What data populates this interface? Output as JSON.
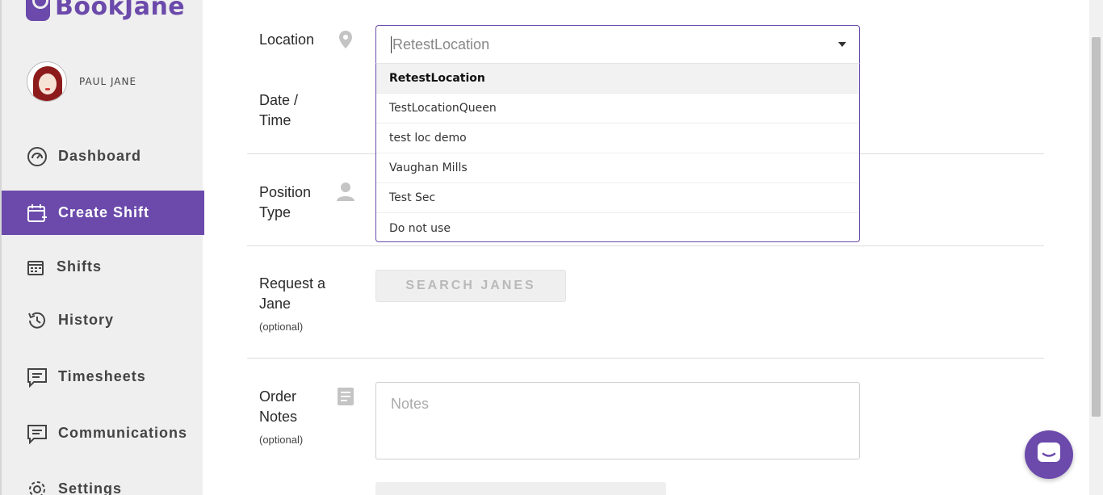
{
  "brand": {
    "name": "BookJane",
    "color": "#6b4aab"
  },
  "user": {
    "name": "PAUL JANE"
  },
  "sidebar": {
    "items": [
      {
        "label": "Dashboard",
        "icon": "dashboard-gauge-icon"
      },
      {
        "label": "Create Shift",
        "icon": "calendar-plus-icon",
        "active": true
      },
      {
        "label": "Shifts",
        "icon": "calendar-icon"
      },
      {
        "label": "History",
        "icon": "history-clock-icon"
      },
      {
        "label": "Timesheets",
        "icon": "timesheet-message-icon"
      },
      {
        "label": "Communications",
        "icon": "communications-message-icon"
      },
      {
        "label": "Settings",
        "icon": "gear-icon"
      }
    ]
  },
  "form": {
    "location": {
      "label": "Location",
      "icon": "location-pin-icon",
      "value": "RetestLocation",
      "options": [
        "RetestLocation",
        "TestLocationQueen",
        "test loc demo",
        "Vaughan Mills",
        "Test Sec",
        "Do not use"
      ],
      "selected_index": 0
    },
    "datetime": {
      "label_line1": "Date /",
      "label_line2": "Time"
    },
    "position": {
      "label_line1": "Position",
      "label_line2": "Type",
      "icon": "person-icon"
    },
    "request": {
      "label_line1": "Request a",
      "label_line2": "Jane",
      "optional": "(optional)",
      "button": "SEARCH JANES"
    },
    "notes": {
      "label_line1": "Order",
      "label_line2": "Notes",
      "optional": "(optional)",
      "placeholder": "Notes",
      "icon": "notes-document-icon"
    }
  },
  "chat": {
    "icon": "chat-bubble-icon"
  }
}
